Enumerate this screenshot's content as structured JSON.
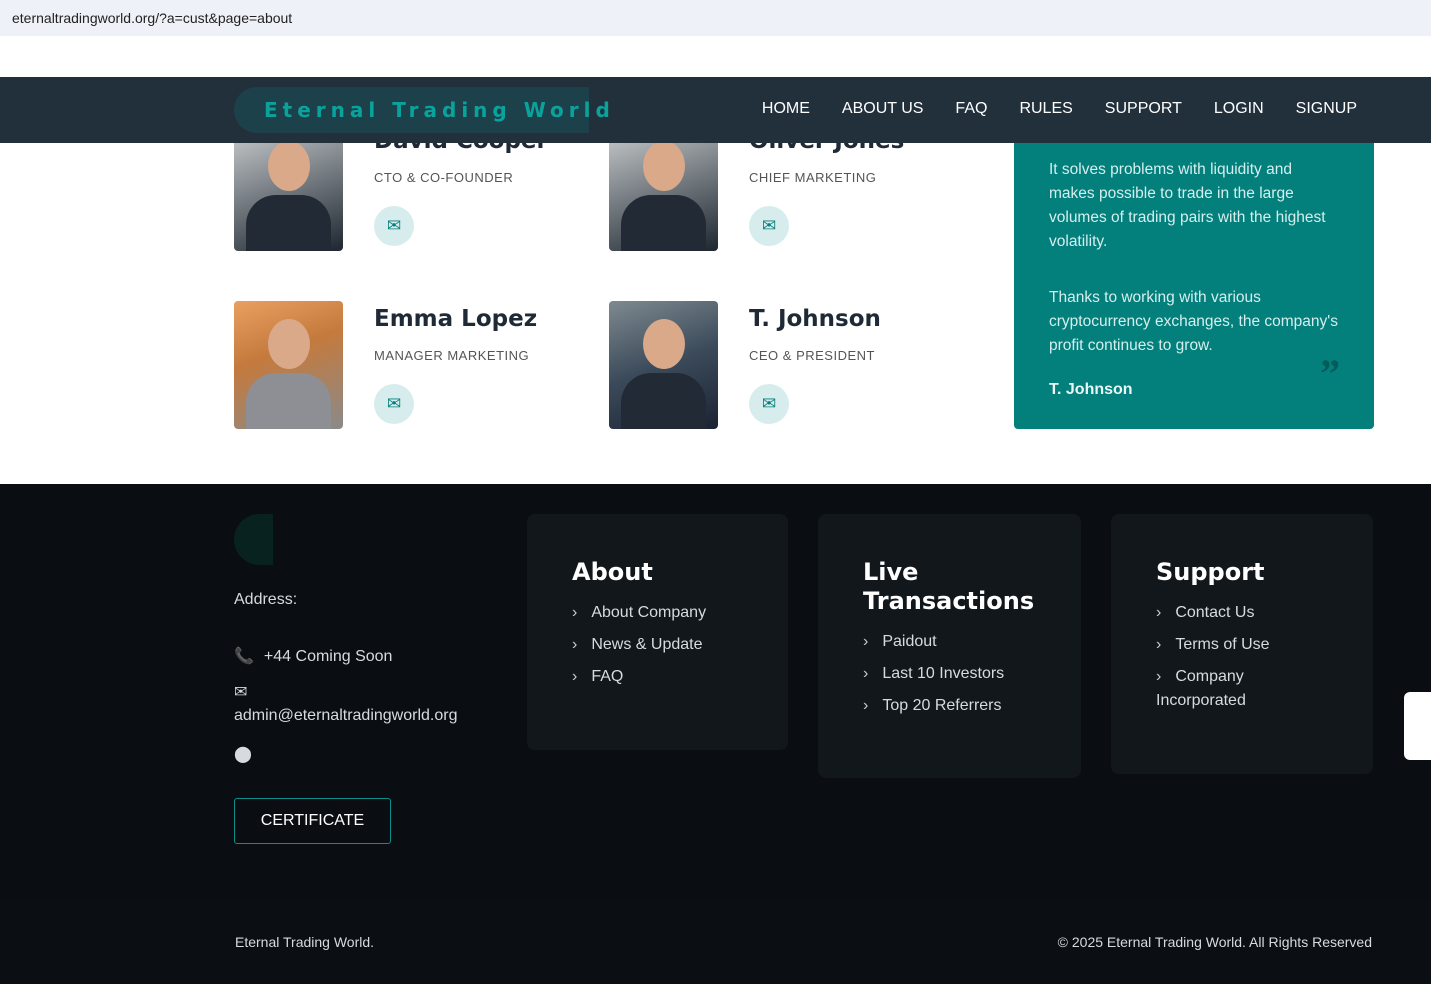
{
  "url": "eternaltradingworld.org/?a=cust&page=about",
  "logo": "Eternal Trading World",
  "nav": [
    "HOME",
    "ABOUT US",
    "FAQ",
    "RULES",
    "SUPPORT",
    "LOGIN",
    "SIGNUP"
  ],
  "team": [
    {
      "name": "David Cooper",
      "role": "CTO & CO-FOUNDER"
    },
    {
      "name": "Oliver Jones",
      "role": "CHIEF MARKETING"
    },
    {
      "name": "Emma Lopez",
      "role": "MANAGER MARKETING"
    },
    {
      "name": "T. Johnson",
      "role": "CEO & PRESIDENT"
    }
  ],
  "testimonial": {
    "p1": "It solves problems with liquidity and makes possible to trade in the large volumes of trading pairs with the highest volatility.",
    "p2": "Thanks to working with various cryptocurrency exchanges, the company's profit continues to grow.",
    "author": "T. Johnson"
  },
  "footer": {
    "address": "Address:",
    "phone": "+44 Coming Soon",
    "email": "admin@eternaltradingworld.org",
    "certificate": "CERTIFICATE",
    "about": {
      "title": "About",
      "links": [
        "About Company",
        "News & Update",
        "FAQ"
      ]
    },
    "live": {
      "title": "Live Transactions",
      "links": [
        "Paidout",
        "Last 10 Investors",
        "Top 20 Referrers"
      ]
    },
    "support": {
      "title": "Support",
      "links": [
        "Contact Us",
        "Terms of Use",
        "Company Incorporated"
      ]
    },
    "left": "Eternal Trading World.",
    "copyright": "© 2025 Eternal Trading World. All Rights Reserved"
  }
}
